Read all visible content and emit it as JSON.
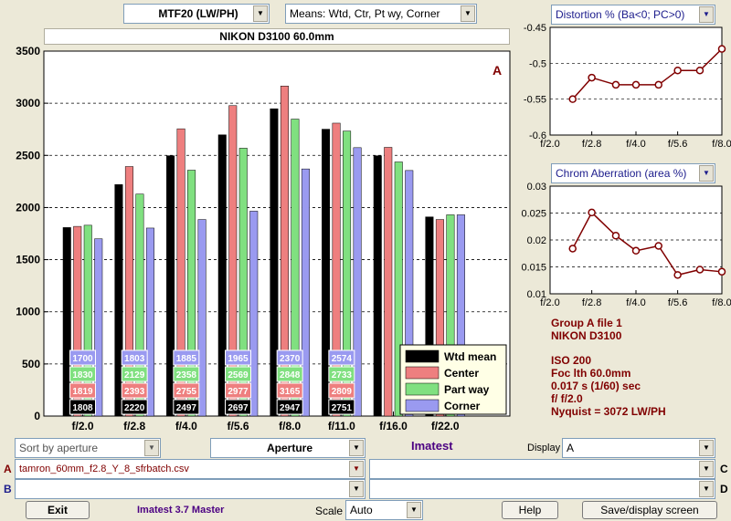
{
  "top": {
    "metric_select": "MTF20 (LW/PH)",
    "means_select": "Means: Wtd, Ctr, Pt wy, Corner",
    "camera_title": "NIKON D3100    60.0mm"
  },
  "distortion_panel": {
    "select": "Distortion %  (Ba<0; PC>0)"
  },
  "chrom_panel": {
    "select": "Chrom Aberration (area %)"
  },
  "info": {
    "group": "Group A file 1",
    "camera": "NIKON D3100",
    "iso": "ISO  200",
    "foc": "Foc lth  60.0mm",
    "exposure": "0.017 s  (1/60)  sec",
    "fstop": "f/  f/2.0",
    "nyquist": "Nyquist = 3072 LW/PH"
  },
  "controls": {
    "sort": "Sort by aperture",
    "xaxis": "Aperture",
    "imatest": "Imatest",
    "display_label": "Display",
    "display_value": "A",
    "row_a_label": "A",
    "file_a": "tamron_60mm_f2.8_Y_8_sfrbatch.csv",
    "row_b_label": "B",
    "file_b": "",
    "row_c_label": "C",
    "file_c": "",
    "row_d_label": "D",
    "file_d": "",
    "exit": "Exit",
    "version": "Imatest 3.7 Master",
    "scale_label": "Scale",
    "scale_value": "Auto",
    "help": "Help",
    "save": "Save/display screen"
  },
  "colors": {
    "wtd_mean": "#000000",
    "center": "#ee7f7f",
    "part_way": "#80e080",
    "corner": "#9a9af0",
    "line_chart": "#800000",
    "group_text": "#800000",
    "imatest_text": "#4b0082"
  },
  "chart_data": [
    {
      "type": "bar",
      "group_label": "A",
      "categories": [
        "f/2.0",
        "f/2.8",
        "f/4.0",
        "f/5.6",
        "f/8.0",
        "f/11.0",
        "f/16.0",
        "f/22.0"
      ],
      "ylim": [
        0,
        3500
      ],
      "yticks": [
        0,
        500,
        1000,
        1500,
        2000,
        2500,
        3000,
        3500
      ],
      "grid": true,
      "legend_position": "bottom-right",
      "series": [
        {
          "name": "Wtd mean",
          "values": [
            1808,
            2220,
            2497,
            2697,
            2947,
            2751,
            2497,
            1910
          ]
        },
        {
          "name": "Center",
          "values": [
            1819,
            2393,
            2755,
            2977,
            3165,
            2809,
            2577,
            1885
          ]
        },
        {
          "name": "Part way",
          "values": [
            1830,
            2129,
            2358,
            2569,
            2848,
            2733,
            2437,
            1930
          ]
        },
        {
          "name": "Corner",
          "values": [
            1700,
            1803,
            1885,
            1965,
            2370,
            2574,
            2355,
            1930
          ]
        }
      ],
      "data_labels_shown_for_categories": 6
    },
    {
      "type": "line",
      "x": [
        2.4,
        2.8,
        3.4,
        4.0,
        4.8,
        5.6,
        6.7,
        8.0
      ],
      "values": [
        -0.55,
        -0.52,
        -0.53,
        -0.53,
        -0.53,
        -0.51,
        -0.51,
        -0.48
      ],
      "xticks": [
        "f/2.0",
        "f/2.8",
        "f/4.0",
        "f/5.6",
        "f/8.0"
      ],
      "ylim": [
        -0.6,
        -0.45
      ],
      "yticks": [
        -0.6,
        -0.55,
        -0.5,
        -0.45
      ],
      "grid": true
    },
    {
      "type": "line",
      "x": [
        2.4,
        2.8,
        3.4,
        4.0,
        4.8,
        5.6,
        6.7,
        8.0
      ],
      "values": [
        0.0184,
        0.0251,
        0.0208,
        0.018,
        0.0189,
        0.0135,
        0.0145,
        0.0141
      ],
      "xticks": [
        "f/2.0",
        "f/2.8",
        "f/4.0",
        "f/5.6",
        "f/8.0"
      ],
      "ylim": [
        0.01,
        0.03
      ],
      "yticks": [
        0.01,
        0.015,
        0.02,
        0.025,
        0.03
      ],
      "grid": true
    }
  ]
}
